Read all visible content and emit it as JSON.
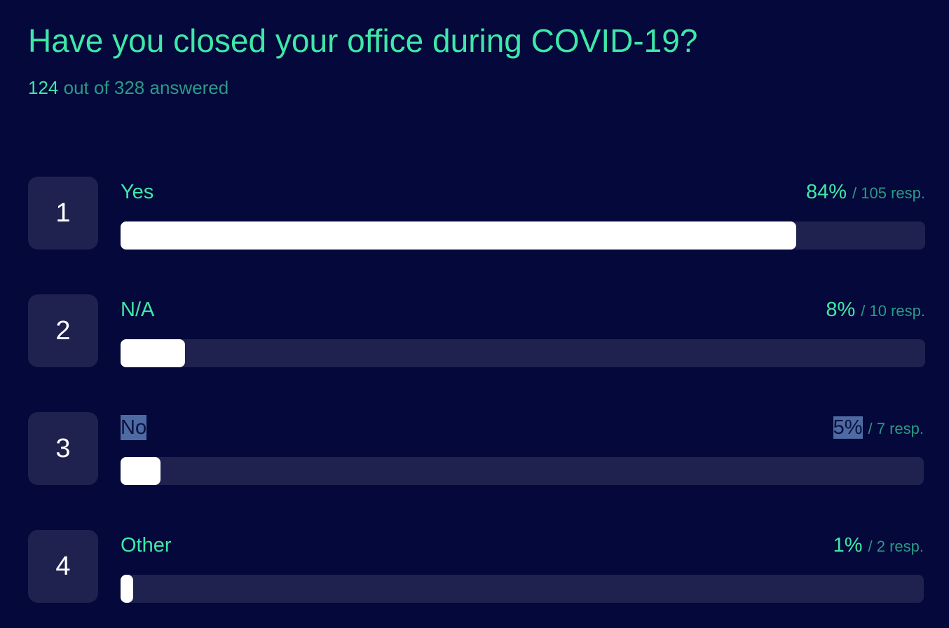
{
  "question": {
    "title": "Have you closed your office during COVID-19?",
    "answered": "124",
    "answered_suffix": " out of 328 answered"
  },
  "options": [
    {
      "index": "1",
      "label": "Yes",
      "percent": "84%",
      "responses": "/ 105 resp.",
      "share": 0.84,
      "selected_text": false
    },
    {
      "index": "2",
      "label": "N/A",
      "percent": "8%",
      "responses": "/ 10 resp.",
      "share": 0.08,
      "selected_text": false
    },
    {
      "index": "3",
      "label": "No",
      "percent": "5%",
      "responses": "/ 7 resp.",
      "share": 0.05,
      "selected_text": true
    },
    {
      "index": "4",
      "label": "Other",
      "percent": "1%",
      "responses": "/ 2 resp.",
      "share": 0.01,
      "selected_text": false
    }
  ],
  "colors": {
    "background": "#04083a",
    "accent": "#3ee8a8",
    "muted_accent": "#2b9a86",
    "track": "#1f224e",
    "fill": "#ffffff",
    "text_selection": "#4e6aa3"
  }
}
